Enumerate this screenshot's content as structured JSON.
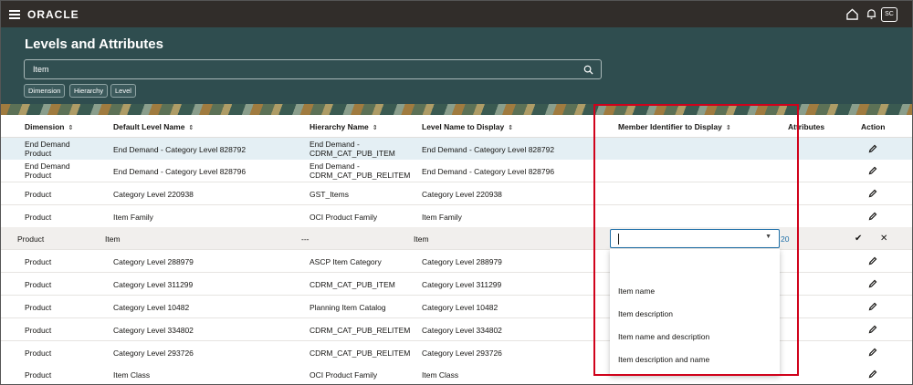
{
  "app": {
    "logo": "ORACLE",
    "avatar": "SC"
  },
  "page": {
    "title": "Levels and Attributes"
  },
  "search": {
    "value": "Item"
  },
  "filters": [
    "Dimension",
    "Hierarchy",
    "Level"
  ],
  "table": {
    "columns": [
      "Dimension",
      "Default Level Name",
      "Hierarchy Name",
      "Level Name to Display",
      "Member Identifier to Display",
      "Attributes",
      "Action"
    ],
    "rows": [
      {
        "dimension": "End Demand\nProduct",
        "default_level": "End Demand - Category Level 828792",
        "hierarchy": "End Demand -\nCDRM_CAT_PUB_ITEM",
        "level_display": "End Demand - Category Level 828792"
      },
      {
        "dimension": "End Demand\nProduct",
        "default_level": "End Demand - Category Level 828796",
        "hierarchy": "End Demand -\nCDRM_CAT_PUB_RELITEM",
        "level_display": "End Demand - Category Level 828796"
      },
      {
        "dimension": "Product",
        "default_level": "Category Level 220938",
        "hierarchy": "GST_Items",
        "level_display": "Category Level 220938"
      },
      {
        "dimension": "Product",
        "default_level": "Item Family",
        "hierarchy": "OCI Product Family",
        "level_display": "Item Family"
      },
      {
        "dimension": "Product",
        "default_level": "Item",
        "hierarchy": "---",
        "level_display": "Item",
        "attributes": "20"
      },
      {
        "dimension": "Product",
        "default_level": "Category Level 288979",
        "hierarchy": "ASCP Item Category",
        "level_display": "Category Level 288979"
      },
      {
        "dimension": "Product",
        "default_level": "Category Level 311299",
        "hierarchy": "CDRM_CAT_PUB_ITEM",
        "level_display": "Category Level 311299"
      },
      {
        "dimension": "Product",
        "default_level": "Category Level 10482",
        "hierarchy": "Planning Item Catalog",
        "level_display": "Category Level 10482"
      },
      {
        "dimension": "Product",
        "default_level": "Category Level 334802",
        "hierarchy": "CDRM_CAT_PUB_RELITEM",
        "level_display": "Category Level 334802"
      },
      {
        "dimension": "Product",
        "default_level": "Category Level 293726",
        "hierarchy": "CDRM_CAT_PUB_RELITEM",
        "level_display": "Category Level 293726"
      },
      {
        "dimension": "Product",
        "default_level": "Item Class",
        "hierarchy": "OCI Product Family",
        "level_display": "Item Class"
      }
    ]
  },
  "dropdown": {
    "value": "",
    "options": [
      "Item name",
      "Item description",
      "Item name and description",
      "Item description and name"
    ]
  },
  "colors": {
    "topbar": "#312d2a",
    "banner": "#2f4d4f",
    "highlight": "#d0021b",
    "link": "#1e6fa8"
  },
  "icons": [
    "hamburger-icon",
    "home-icon",
    "bell-icon",
    "search-icon",
    "sort-icon",
    "pencil-icon",
    "check-icon",
    "close-icon",
    "chevron-down-icon"
  ]
}
